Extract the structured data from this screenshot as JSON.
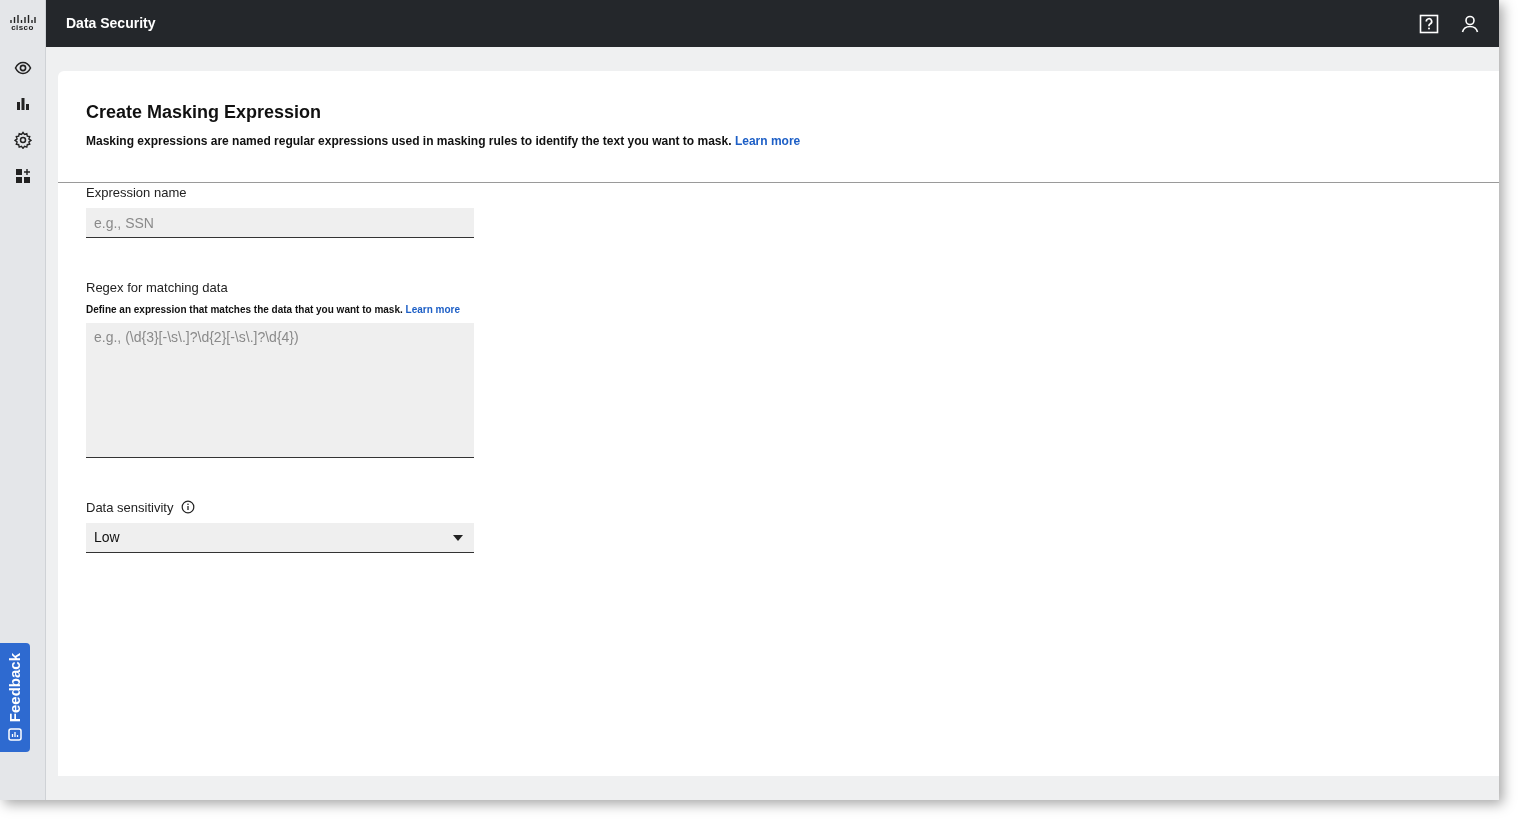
{
  "logo": {
    "text": "cisco"
  },
  "header": {
    "title": "Data Security"
  },
  "feedback": {
    "label": "Feedback"
  },
  "page": {
    "title": "Create Masking Expression",
    "description": "Masking expressions are named regular expressions used in masking rules to identify the text you want to mask.",
    "link": "Learn more"
  },
  "form": {
    "fields": [
      {
        "kind": "text",
        "label": "Expression name",
        "placeholder": "e.g., SSN"
      },
      {
        "kind": "textarea",
        "label": "Regex for matching data",
        "hint": "Define an expression that matches the data that you want to mask.",
        "hint_link": "Learn more",
        "placeholder": "e.g., (\\d{3}[-\\s\\.]?\\d{2}[-\\s\\.]?\\d{4})"
      },
      {
        "kind": "select",
        "label": "Data sensitivity",
        "value": "Low"
      }
    ]
  }
}
